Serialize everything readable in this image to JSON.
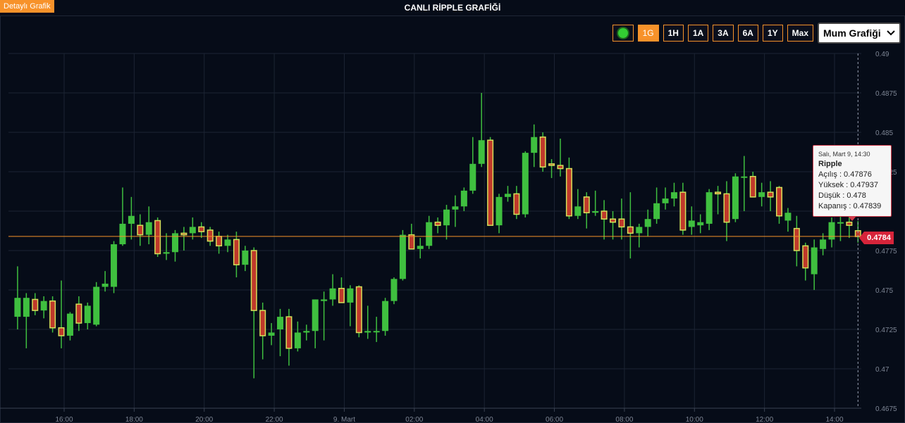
{
  "header": {
    "detail_button": "Detaylı Grafik",
    "title": "CANLI RİPPLE GRAFİĞİ"
  },
  "toolbar": {
    "live_icon": "live-dot-icon",
    "ranges": [
      "1G",
      "1H",
      "1A",
      "3A",
      "6A",
      "1Y",
      "Max"
    ],
    "active_range": "1G",
    "chart_type": "Mum Grafiği",
    "chart_type_icon": "chevron-down-icon"
  },
  "tooltip": {
    "date": "Salı, Mart 9, 14:30",
    "name": "Ripple",
    "open": "Açılış : 0.47876",
    "high": "Yüksek : 0.47937",
    "low": "Düşük : 0.478",
    "close": "Kapanış : 0.47839"
  },
  "current_price_label": "0.4784",
  "colors": {
    "background": "#060c18",
    "grid": "#1c2433",
    "up": "#3fbf3f",
    "down": "#c0392b",
    "down_border": "#d4e05a",
    "price_line": "#f7922a",
    "axis_text": "#7d8594",
    "accent": "#f7922a"
  },
  "chart_data": {
    "type": "candlestick",
    "title": "CANLI RİPPLE GRAFİĞİ",
    "ylim": [
      0.4675,
      0.49
    ],
    "y_ticks": [
      "0.4675",
      "0.47",
      "0.4725",
      "0.475",
      "0.4775",
      "0.48",
      "0.4825",
      "0.485",
      "0.4875",
      "0.49"
    ],
    "x_ticks": [
      "16:00",
      "18:00",
      "20:00",
      "22:00",
      "9. Mart",
      "02:00",
      "04:00",
      "06:00",
      "08:00",
      "10:00",
      "12:00",
      "14:00"
    ],
    "x_tick_hours": [
      16,
      18,
      20,
      22,
      24,
      26,
      28,
      30,
      32,
      34,
      36,
      38
    ],
    "candle_interval_minutes": 15,
    "current_price": 0.4784,
    "grid": true,
    "candles": [
      {
        "t": 14.67,
        "o": 0.4733,
        "h": 0.4765,
        "l": 0.4725,
        "c": 0.4745
      },
      {
        "t": 14.92,
        "o": 0.4733,
        "h": 0.4748,
        "l": 0.4713,
        "c": 0.4745
      },
      {
        "t": 15.17,
        "o": 0.4744,
        "h": 0.4748,
        "l": 0.4734,
        "c": 0.4737
      },
      {
        "t": 15.42,
        "o": 0.4737,
        "h": 0.4746,
        "l": 0.4732,
        "c": 0.4743
      },
      {
        "t": 15.67,
        "o": 0.4743,
        "h": 0.4746,
        "l": 0.4723,
        "c": 0.4726
      },
      {
        "t": 15.92,
        "o": 0.4726,
        "h": 0.4756,
        "l": 0.4713,
        "c": 0.4721
      },
      {
        "t": 16.17,
        "o": 0.4721,
        "h": 0.4736,
        "l": 0.4718,
        "c": 0.4735
      },
      {
        "t": 16.42,
        "o": 0.4741,
        "h": 0.4746,
        "l": 0.4724,
        "c": 0.4729
      },
      {
        "t": 16.67,
        "o": 0.4729,
        "h": 0.4742,
        "l": 0.4725,
        "c": 0.474
      },
      {
        "t": 16.92,
        "o": 0.4728,
        "h": 0.4755,
        "l": 0.4727,
        "c": 0.4752
      },
      {
        "t": 17.17,
        "o": 0.4752,
        "h": 0.4762,
        "l": 0.4749,
        "c": 0.4754
      },
      {
        "t": 17.42,
        "o": 0.4752,
        "h": 0.4781,
        "l": 0.4748,
        "c": 0.4779
      },
      {
        "t": 17.67,
        "o": 0.4779,
        "h": 0.4815,
        "l": 0.4778,
        "c": 0.4792
      },
      {
        "t": 17.92,
        "o": 0.4792,
        "h": 0.4809,
        "l": 0.4782,
        "c": 0.4797
      },
      {
        "t": 18.17,
        "o": 0.4791,
        "h": 0.4798,
        "l": 0.4778,
        "c": 0.4785
      },
      {
        "t": 18.42,
        "o": 0.4785,
        "h": 0.4803,
        "l": 0.4779,
        "c": 0.4793
      },
      {
        "t": 18.67,
        "o": 0.4794,
        "h": 0.4796,
        "l": 0.4771,
        "c": 0.4773
      },
      {
        "t": 18.92,
        "o": 0.4773,
        "h": 0.4786,
        "l": 0.4769,
        "c": 0.4774
      },
      {
        "t": 19.17,
        "o": 0.4774,
        "h": 0.4788,
        "l": 0.4768,
        "c": 0.4786
      },
      {
        "t": 19.42,
        "o": 0.4786,
        "h": 0.479,
        "l": 0.4775,
        "c": 0.4785
      },
      {
        "t": 19.67,
        "o": 0.4786,
        "h": 0.4796,
        "l": 0.4782,
        "c": 0.479
      },
      {
        "t": 19.92,
        "o": 0.479,
        "h": 0.4793,
        "l": 0.4783,
        "c": 0.4787
      },
      {
        "t": 20.17,
        "o": 0.4788,
        "h": 0.479,
        "l": 0.4778,
        "c": 0.4781
      },
      {
        "t": 20.42,
        "o": 0.4784,
        "h": 0.4787,
        "l": 0.4773,
        "c": 0.4778
      },
      {
        "t": 20.67,
        "o": 0.4778,
        "h": 0.4785,
        "l": 0.4774,
        "c": 0.4782
      },
      {
        "t": 20.92,
        "o": 0.4782,
        "h": 0.4787,
        "l": 0.4758,
        "c": 0.4766
      },
      {
        "t": 21.17,
        "o": 0.4766,
        "h": 0.4778,
        "l": 0.4762,
        "c": 0.4775
      },
      {
        "t": 21.42,
        "o": 0.4775,
        "h": 0.4777,
        "l": 0.4694,
        "c": 0.4737
      },
      {
        "t": 21.67,
        "o": 0.4737,
        "h": 0.4742,
        "l": 0.4706,
        "c": 0.4721
      },
      {
        "t": 21.92,
        "o": 0.4721,
        "h": 0.4729,
        "l": 0.4715,
        "c": 0.4723
      },
      {
        "t": 22.17,
        "o": 0.4725,
        "h": 0.4738,
        "l": 0.4708,
        "c": 0.4733
      },
      {
        "t": 22.42,
        "o": 0.4733,
        "h": 0.4738,
        "l": 0.4702,
        "c": 0.4713
      },
      {
        "t": 22.67,
        "o": 0.4713,
        "h": 0.473,
        "l": 0.4711,
        "c": 0.4723
      },
      {
        "t": 22.92,
        "o": 0.4723,
        "h": 0.4728,
        "l": 0.4718,
        "c": 0.4724
      },
      {
        "t": 23.17,
        "o": 0.4724,
        "h": 0.4744,
        "l": 0.4713,
        "c": 0.4744
      },
      {
        "t": 23.42,
        "o": 0.4743,
        "h": 0.4749,
        "l": 0.4718,
        "c": 0.4744
      },
      {
        "t": 23.67,
        "o": 0.4744,
        "h": 0.476,
        "l": 0.474,
        "c": 0.4751
      },
      {
        "t": 23.92,
        "o": 0.4751,
        "h": 0.4758,
        "l": 0.4744,
        "c": 0.4742
      },
      {
        "t": 24.17,
        "o": 0.4742,
        "h": 0.4753,
        "l": 0.4727,
        "c": 0.4751
      },
      {
        "t": 24.42,
        "o": 0.4752,
        "h": 0.4753,
        "l": 0.472,
        "c": 0.4723
      },
      {
        "t": 24.67,
        "o": 0.4723,
        "h": 0.474,
        "l": 0.4719,
        "c": 0.4724
      },
      {
        "t": 24.92,
        "o": 0.4724,
        "h": 0.4733,
        "l": 0.4717,
        "c": 0.4724
      },
      {
        "t": 25.17,
        "o": 0.4724,
        "h": 0.4745,
        "l": 0.4721,
        "c": 0.4743
      },
      {
        "t": 25.42,
        "o": 0.4743,
        "h": 0.4758,
        "l": 0.4741,
        "c": 0.4757
      },
      {
        "t": 25.67,
        "o": 0.4757,
        "h": 0.4788,
        "l": 0.4756,
        "c": 0.4785
      },
      {
        "t": 25.92,
        "o": 0.4785,
        "h": 0.4792,
        "l": 0.4776,
        "c": 0.4776
      },
      {
        "t": 26.17,
        "o": 0.4776,
        "h": 0.4783,
        "l": 0.477,
        "c": 0.4778
      },
      {
        "t": 26.42,
        "o": 0.4778,
        "h": 0.4797,
        "l": 0.4776,
        "c": 0.4793
      },
      {
        "t": 26.67,
        "o": 0.4793,
        "h": 0.4796,
        "l": 0.4786,
        "c": 0.4791
      },
      {
        "t": 26.92,
        "o": 0.4791,
        "h": 0.4804,
        "l": 0.4782,
        "c": 0.4801
      },
      {
        "t": 27.17,
        "o": 0.4801,
        "h": 0.481,
        "l": 0.479,
        "c": 0.4803
      },
      {
        "t": 27.42,
        "o": 0.4803,
        "h": 0.4815,
        "l": 0.48,
        "c": 0.4813
      },
      {
        "t": 27.67,
        "o": 0.4813,
        "h": 0.4847,
        "l": 0.4811,
        "c": 0.483
      },
      {
        "t": 27.92,
        "o": 0.483,
        "h": 0.4875,
        "l": 0.4828,
        "c": 0.4845
      },
      {
        "t": 28.17,
        "o": 0.4845,
        "h": 0.4847,
        "l": 0.4791,
        "c": 0.4791
      },
      {
        "t": 28.42,
        "o": 0.4791,
        "h": 0.4811,
        "l": 0.4786,
        "c": 0.4809
      },
      {
        "t": 28.67,
        "o": 0.4809,
        "h": 0.4816,
        "l": 0.4806,
        "c": 0.4811
      },
      {
        "t": 28.92,
        "o": 0.4811,
        "h": 0.4816,
        "l": 0.4795,
        "c": 0.4798
      },
      {
        "t": 29.17,
        "o": 0.4798,
        "h": 0.4838,
        "l": 0.4796,
        "c": 0.4837
      },
      {
        "t": 29.42,
        "o": 0.4837,
        "h": 0.4855,
        "l": 0.4828,
        "c": 0.4847
      },
      {
        "t": 29.67,
        "o": 0.4847,
        "h": 0.485,
        "l": 0.4825,
        "c": 0.4828
      },
      {
        "t": 29.92,
        "o": 0.483,
        "h": 0.4833,
        "l": 0.4821,
        "c": 0.4829
      },
      {
        "t": 30.17,
        "o": 0.4829,
        "h": 0.4846,
        "l": 0.4822,
        "c": 0.4827
      },
      {
        "t": 30.42,
        "o": 0.4827,
        "h": 0.4834,
        "l": 0.4795,
        "c": 0.4797
      },
      {
        "t": 30.67,
        "o": 0.4797,
        "h": 0.4814,
        "l": 0.4795,
        "c": 0.4803
      },
      {
        "t": 30.92,
        "o": 0.4809,
        "h": 0.4812,
        "l": 0.4789,
        "c": 0.4799
      },
      {
        "t": 31.17,
        "o": 0.4799,
        "h": 0.4813,
        "l": 0.4797,
        "c": 0.48
      },
      {
        "t": 31.42,
        "o": 0.48,
        "h": 0.4807,
        "l": 0.4782,
        "c": 0.4795
      },
      {
        "t": 31.67,
        "o": 0.4795,
        "h": 0.48,
        "l": 0.4782,
        "c": 0.4793
      },
      {
        "t": 31.92,
        "o": 0.4795,
        "h": 0.4808,
        "l": 0.4782,
        "c": 0.479
      },
      {
        "t": 32.17,
        "o": 0.479,
        "h": 0.4812,
        "l": 0.477,
        "c": 0.4786
      },
      {
        "t": 32.42,
        "o": 0.4786,
        "h": 0.4792,
        "l": 0.4777,
        "c": 0.479
      },
      {
        "t": 32.67,
        "o": 0.479,
        "h": 0.4801,
        "l": 0.4784,
        "c": 0.4795
      },
      {
        "t": 32.92,
        "o": 0.4795,
        "h": 0.4815,
        "l": 0.4792,
        "c": 0.4805
      },
      {
        "t": 33.17,
        "o": 0.4805,
        "h": 0.4815,
        "l": 0.4801,
        "c": 0.4808
      },
      {
        "t": 33.42,
        "o": 0.4808,
        "h": 0.4818,
        "l": 0.4803,
        "c": 0.4812
      },
      {
        "t": 33.67,
        "o": 0.4812,
        "h": 0.4818,
        "l": 0.4785,
        "c": 0.4788
      },
      {
        "t": 33.92,
        "o": 0.479,
        "h": 0.4803,
        "l": 0.4785,
        "c": 0.4794
      },
      {
        "t": 34.17,
        "o": 0.4791,
        "h": 0.4798,
        "l": 0.4786,
        "c": 0.4793
      },
      {
        "t": 34.42,
        "o": 0.4792,
        "h": 0.4814,
        "l": 0.4788,
        "c": 0.4812
      },
      {
        "t": 34.67,
        "o": 0.4812,
        "h": 0.4816,
        "l": 0.4798,
        "c": 0.4811
      },
      {
        "t": 34.92,
        "o": 0.4811,
        "h": 0.4819,
        "l": 0.4781,
        "c": 0.4793
      },
      {
        "t": 35.17,
        "o": 0.4795,
        "h": 0.4824,
        "l": 0.4793,
        "c": 0.4822
      },
      {
        "t": 35.42,
        "o": 0.4822,
        "h": 0.4835,
        "l": 0.48,
        "c": 0.4822
      },
      {
        "t": 35.67,
        "o": 0.4822,
        "h": 0.4825,
        "l": 0.4809,
        "c": 0.4809
      },
      {
        "t": 35.92,
        "o": 0.4809,
        "h": 0.4818,
        "l": 0.4803,
        "c": 0.4812
      },
      {
        "t": 36.17,
        "o": 0.4812,
        "h": 0.4819,
        "l": 0.48,
        "c": 0.4809
      },
      {
        "t": 36.42,
        "o": 0.4815,
        "h": 0.4816,
        "l": 0.4792,
        "c": 0.4797
      },
      {
        "t": 36.67,
        "o": 0.4794,
        "h": 0.4802,
        "l": 0.4787,
        "c": 0.4799
      },
      {
        "t": 36.92,
        "o": 0.4789,
        "h": 0.4797,
        "l": 0.4765,
        "c": 0.4775
      },
      {
        "t": 37.17,
        "o": 0.4778,
        "h": 0.478,
        "l": 0.4756,
        "c": 0.4764
      },
      {
        "t": 37.42,
        "o": 0.476,
        "h": 0.4782,
        "l": 0.475,
        "c": 0.4777
      },
      {
        "t": 37.67,
        "o": 0.4776,
        "h": 0.4786,
        "l": 0.4772,
        "c": 0.4782
      },
      {
        "t": 37.92,
        "o": 0.4782,
        "h": 0.4796,
        "l": 0.4777,
        "c": 0.4793
      },
      {
        "t": 38.17,
        "o": 0.4793,
        "h": 0.4798,
        "l": 0.4781,
        "c": 0.4793
      },
      {
        "t": 38.42,
        "o": 0.4793,
        "h": 0.4798,
        "l": 0.4783,
        "c": 0.4791
      },
      {
        "t": 38.67,
        "o": 0.47876,
        "h": 0.47937,
        "l": 0.478,
        "c": 0.47839
      }
    ]
  }
}
